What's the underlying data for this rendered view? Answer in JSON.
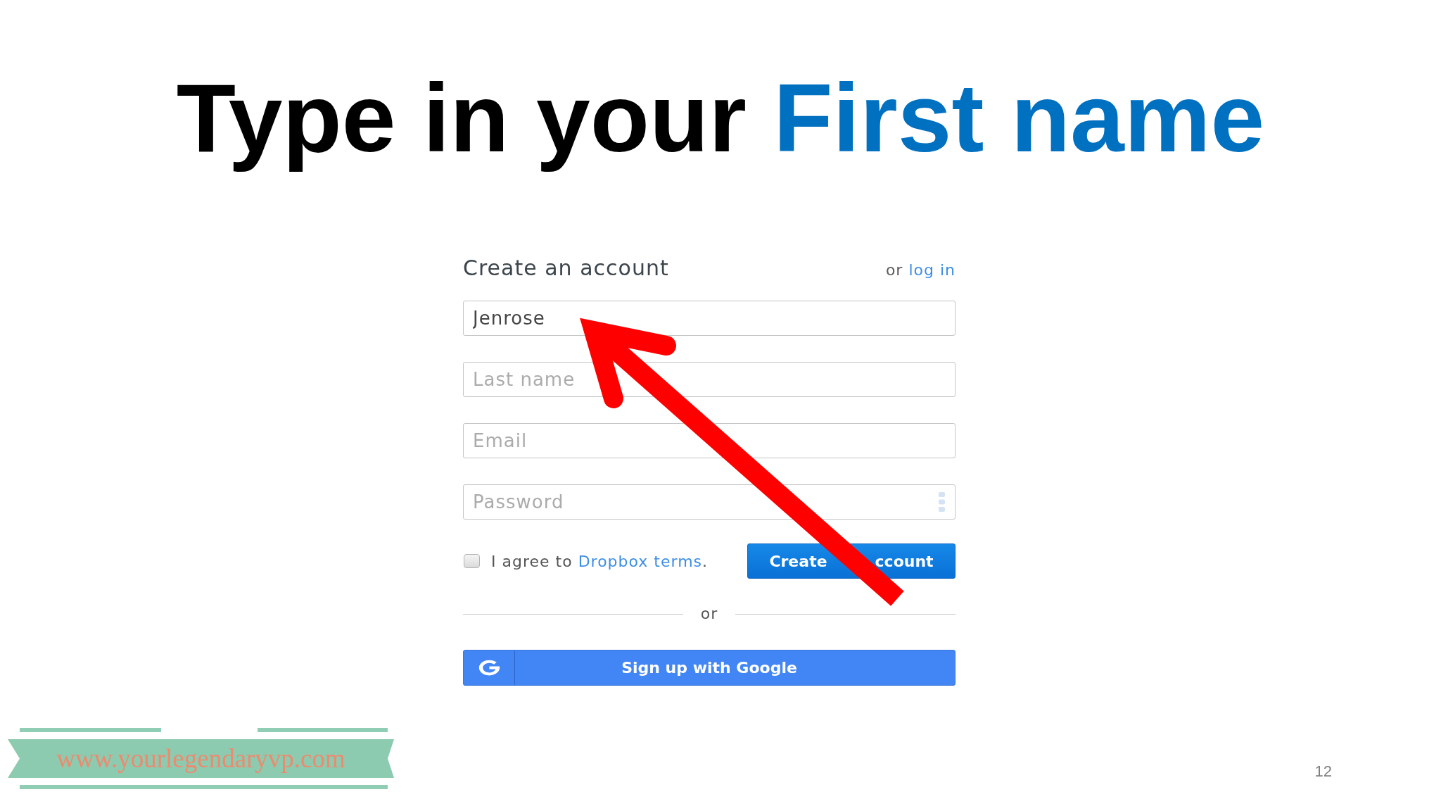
{
  "slide": {
    "title": {
      "text": "Type in your",
      "highlight": "First name"
    }
  },
  "form": {
    "heading": "Create an account",
    "login_prompt": {
      "text": "or",
      "link": "log in"
    },
    "fields": [
      {
        "kind": "text",
        "value": "Jenrose"
      },
      {
        "kind": "text",
        "placeholder": "Last name"
      },
      {
        "kind": "text",
        "placeholder": "Email"
      },
      {
        "kind": "password",
        "placeholder": "Password"
      }
    ],
    "terms": {
      "checked": false,
      "text": "I agree to",
      "link": "Dropbox terms",
      "suffix": "."
    },
    "submit_button": {
      "visible_parts": [
        "Create",
        "ccount"
      ]
    },
    "divider": "or",
    "google_button": "Sign up with Google"
  },
  "footer": {
    "website": "www.yourlegendaryvp.com",
    "page_number": "12"
  }
}
